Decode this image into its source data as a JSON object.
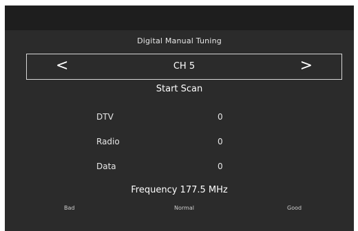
{
  "title": "Digital Manual Tuning",
  "channel": {
    "prev_icon": "<",
    "label": "CH 5",
    "next_icon": ">"
  },
  "start_scan_label": "Start Scan",
  "stats": [
    {
      "label": "DTV",
      "value": "0"
    },
    {
      "label": "Radio",
      "value": "0"
    },
    {
      "label": "Data",
      "value": "0"
    }
  ],
  "frequency_text": "Frequency 177.5 MHz",
  "signal_quality": {
    "bad": "Bad",
    "normal": "Normal",
    "good": "Good"
  }
}
